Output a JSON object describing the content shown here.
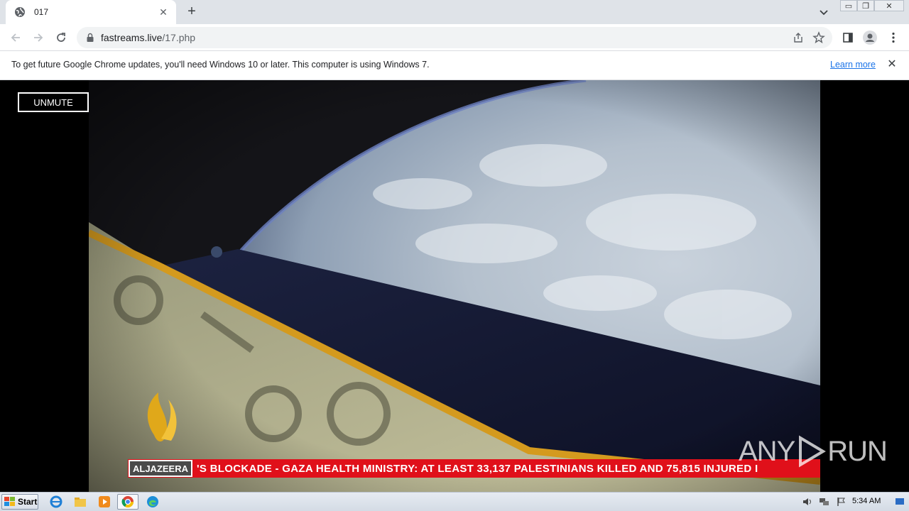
{
  "browser": {
    "tab": {
      "title": "017",
      "close": "✕"
    },
    "new_tab": "+",
    "url": {
      "host": "fastreams.live",
      "path": "/17.php"
    },
    "window_controls": {
      "minimize": "▭",
      "restore": "❐",
      "close": "✕"
    }
  },
  "infobar": {
    "message": "To get future Google Chrome updates, you'll need Windows 10 or later. This computer is using Windows 7.",
    "link": "Learn more",
    "close": "✕"
  },
  "player": {
    "unmute_label": "UNMUTE",
    "channel_logo_text": "ALJAZEERA",
    "ticker_text": "'S BLOCKADE   -   GAZA HEALTH MINISTRY: AT LEAST 33,137 PALESTINIANS KILLED AND 75,815 INJURED I"
  },
  "watermark": {
    "left": "ANY",
    "right": "RUN"
  },
  "taskbar": {
    "start_label": "Start",
    "clock": "5:34 AM"
  },
  "colors": {
    "ticker_red": "#e0101a",
    "link_blue": "#1a73e8",
    "tab_strip": "#dfe3e8"
  }
}
